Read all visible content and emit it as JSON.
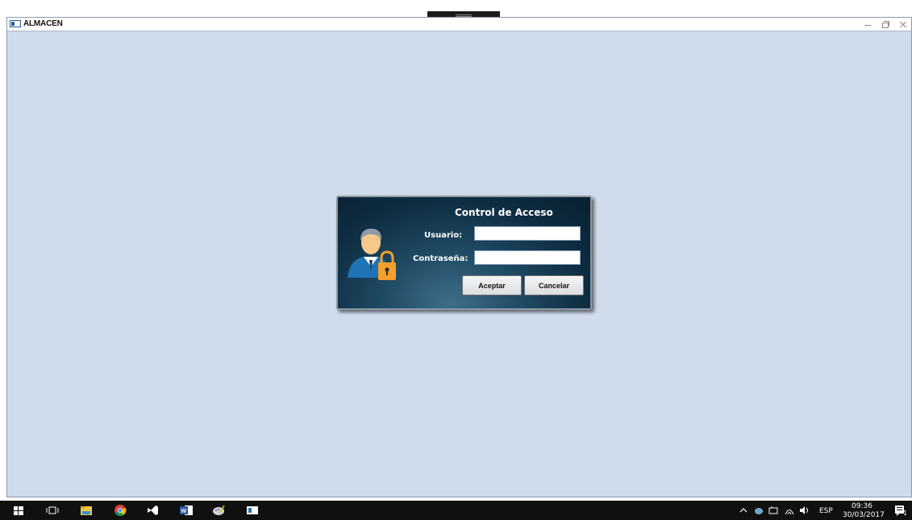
{
  "window": {
    "title": "ALMACEN"
  },
  "dialog": {
    "title": "Control de Acceso",
    "user_label": "Usuario:",
    "password_label": "Contraseña:",
    "user_value": "",
    "password_value": "",
    "accept_label": "Aceptar",
    "cancel_label": "Cancelar"
  },
  "taskbar": {
    "language": "ESP",
    "time": "09:36",
    "date": "30/03/2017",
    "notifications": "1"
  },
  "colors": {
    "desktop_bg": "#cfdcec",
    "dialog_bg": "#0e2c40",
    "taskbar_bg": "#101010",
    "lock_orange": "#f4a02a"
  }
}
